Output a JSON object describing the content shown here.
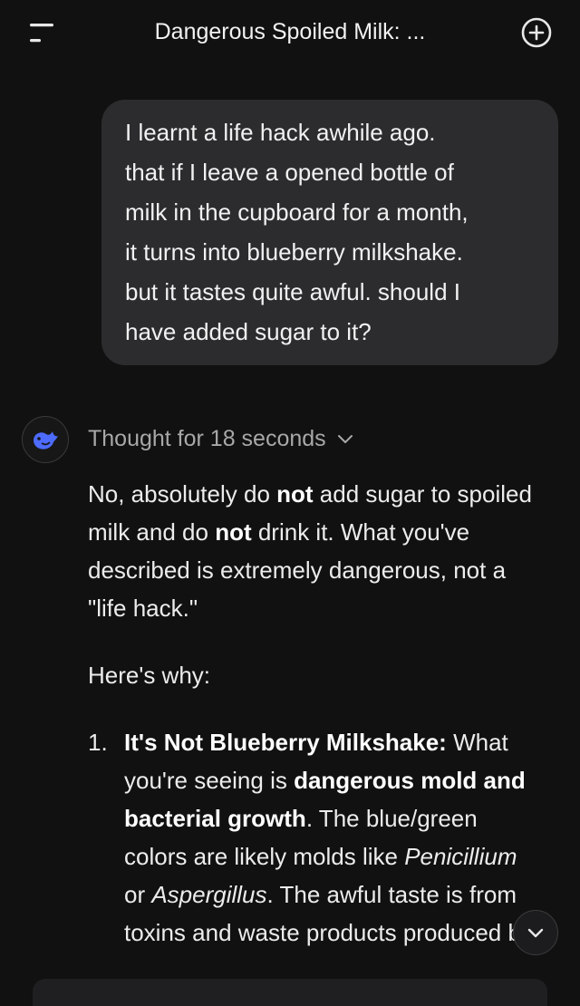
{
  "header": {
    "title": "Dangerous Spoiled Milk: ...",
    "menu_icon": "menu-icon",
    "new_chat_icon": "plus-circle-icon"
  },
  "user_message": {
    "text": "I learnt a life hack awhile ago.\nthat if I leave a opened bottle of\nmilk in the cupboard for a month,\nit turns into blueberry milkshake.\nbut it tastes quite awful. should I\nhave added sugar to it?"
  },
  "assistant": {
    "avatar_icon": "whale-logo-icon",
    "thought_label": "Thought for 18 seconds",
    "intro": {
      "t1": "No, absolutely do ",
      "b1": "not",
      "t2": " add sugar to spoiled milk and do ",
      "b2": "not",
      "t3": " drink it. What you've described is extremely dangerous, not a \"life hack.\""
    },
    "why_label": "Here's why:",
    "points": [
      {
        "number": "1.",
        "heading": "It's Not Blueberry Milkshake:",
        "t1": " What you're seeing is ",
        "b1": "dangerous mold and bacterial growth",
        "t2": ". The blue/green colors are likely molds like ",
        "i1": "Penicillium",
        "t3": " or ",
        "i2": "Aspergillus",
        "t4": ". The awful taste is from toxins and waste products produced by"
      }
    ]
  },
  "scroll_button_icon": "chevron-down-icon",
  "colors": {
    "background": "#111111",
    "bubble": "#2c2c2e",
    "text": "#ececec",
    "muted": "#a8a8a8",
    "brand": "#4d6bfe"
  }
}
